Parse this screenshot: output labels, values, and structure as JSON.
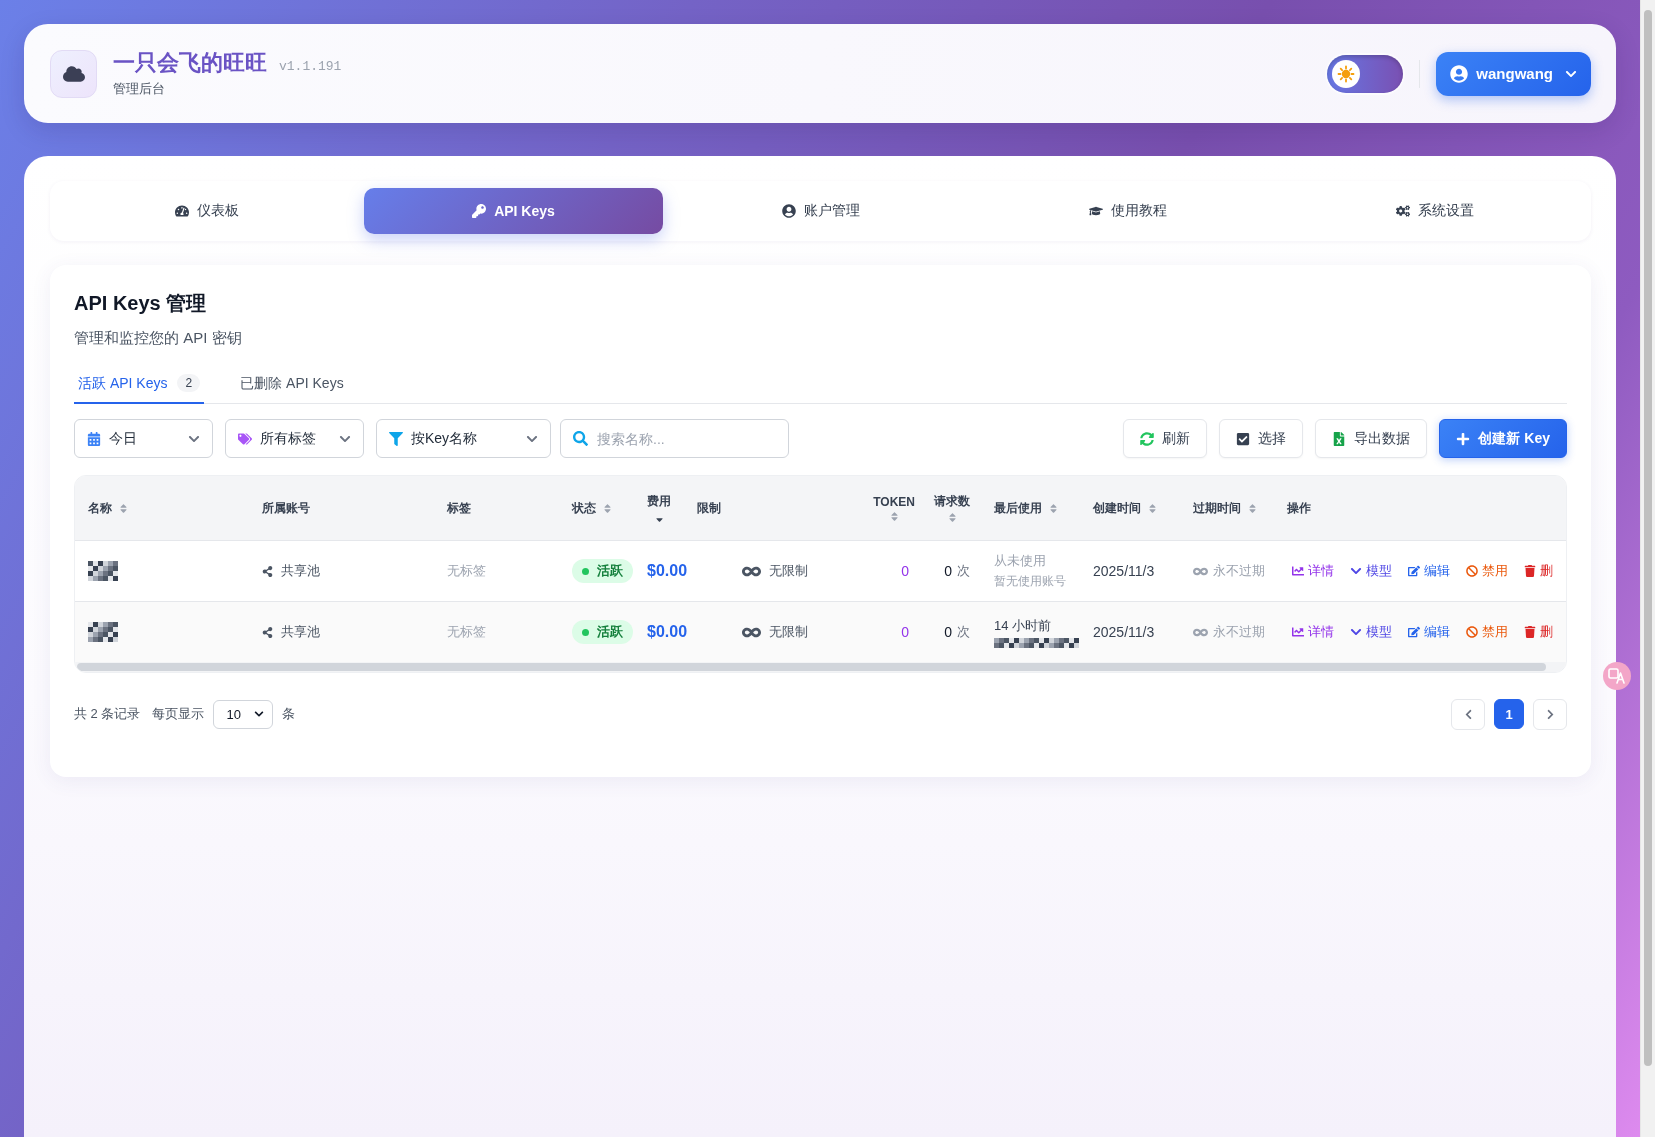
{
  "header": {
    "app_title": "一只会飞的旺旺",
    "version": "v1.1.191",
    "subtitle": "管理后台",
    "dark_mode": false,
    "user_menu": {
      "username": "wangwang"
    }
  },
  "nav_tabs": [
    {
      "label": "仪表板",
      "selected": false
    },
    {
      "label": "API Keys",
      "selected": true
    },
    {
      "label": "账户管理",
      "selected": false
    },
    {
      "label": "使用教程",
      "selected": false
    },
    {
      "label": "系统设置",
      "selected": false
    }
  ],
  "panel": {
    "title": "API Keys 管理",
    "description": "管理和监控您的 API 密钥",
    "key_tabs": [
      {
        "label": "活跃 API Keys",
        "count": "2",
        "selected": true
      },
      {
        "label": "已删除 API Keys",
        "selected": false
      }
    ],
    "filters": [
      {
        "kind": "select",
        "value": "今日"
      },
      {
        "kind": "select",
        "value": "所有标签"
      },
      {
        "kind": "select",
        "value": "按Key名称"
      },
      {
        "kind": "search",
        "placeholder": "搜索名称..."
      }
    ],
    "toolbar_buttons": [
      {
        "label": "刷新",
        "kind": "outline"
      },
      {
        "label": "选择",
        "kind": "outline"
      },
      {
        "label": "导出数据",
        "kind": "outline"
      },
      {
        "label": "创建新 Key",
        "kind": "primary"
      }
    ],
    "table": {
      "columns": [
        {
          "label": "名称",
          "sortable": true,
          "sorted_descending": false
        },
        {
          "label": "所属账号",
          "sortable": false,
          "sorted_descending": false
        },
        {
          "label": "标签",
          "sortable": false,
          "sorted_descending": false
        },
        {
          "label": "状态",
          "sortable": true,
          "sorted_descending": false
        },
        {
          "label": "费用",
          "sortable": true,
          "sorted_descending": true
        },
        {
          "label": "限制",
          "sortable": false,
          "sorted_descending": false
        },
        {
          "label": "TOKEN",
          "sortable": true,
          "sorted_descending": false
        },
        {
          "label": "请求数",
          "sortable": true,
          "sorted_descending": false
        },
        {
          "label": "最后使用",
          "sortable": true,
          "sorted_descending": false
        },
        {
          "label": "创建时间",
          "sortable": true,
          "sorted_descending": false
        },
        {
          "label": "过期时间",
          "sortable": true,
          "sorted_descending": false
        },
        {
          "label": "操作",
          "sortable": false,
          "sorted_descending": false
        }
      ],
      "rows": [
        {
          "name_redacted": true,
          "account": "共享池",
          "tags": "无标签",
          "status": {
            "kind": "active",
            "label": "活跃"
          },
          "cost": "$0.00",
          "limit": "无限制",
          "tokens": "0",
          "requests": "0",
          "requests_unit": "次",
          "last_used": {
            "time": "从未使用",
            "detail": "暂无使用账号",
            "used": false,
            "detail_redacted": false
          },
          "created": "2025/11/3",
          "expires": "永不过期",
          "actions": [
            {
              "kind": "details",
              "label": "详情"
            },
            {
              "kind": "models",
              "label": "模型"
            },
            {
              "kind": "edit",
              "label": "编辑"
            },
            {
              "kind": "disable",
              "label": "禁用"
            },
            {
              "kind": "delete",
              "label": "删"
            }
          ]
        },
        {
          "name_redacted": true,
          "account": "共享池",
          "tags": "无标签",
          "status": {
            "kind": "active",
            "label": "活跃"
          },
          "cost": "$0.00",
          "limit": "无限制",
          "tokens": "0",
          "requests": "0",
          "requests_unit": "次",
          "last_used": {
            "time": "14 小时前",
            "used": true,
            "detail_redacted": true
          },
          "created": "2025/11/3",
          "expires": "永不过期",
          "actions": [
            {
              "kind": "details",
              "label": "详情"
            },
            {
              "kind": "models",
              "label": "模型"
            },
            {
              "kind": "edit",
              "label": "编辑"
            },
            {
              "kind": "disable",
              "label": "禁用"
            },
            {
              "kind": "delete",
              "label": "删"
            }
          ]
        }
      ]
    },
    "pagination": {
      "summary": "共 2 条记录",
      "page_size_label": "每页显示",
      "page_size": "10",
      "page_size_unit": "条",
      "pages": [
        {
          "label": "1",
          "selected": true
        }
      ]
    }
  }
}
